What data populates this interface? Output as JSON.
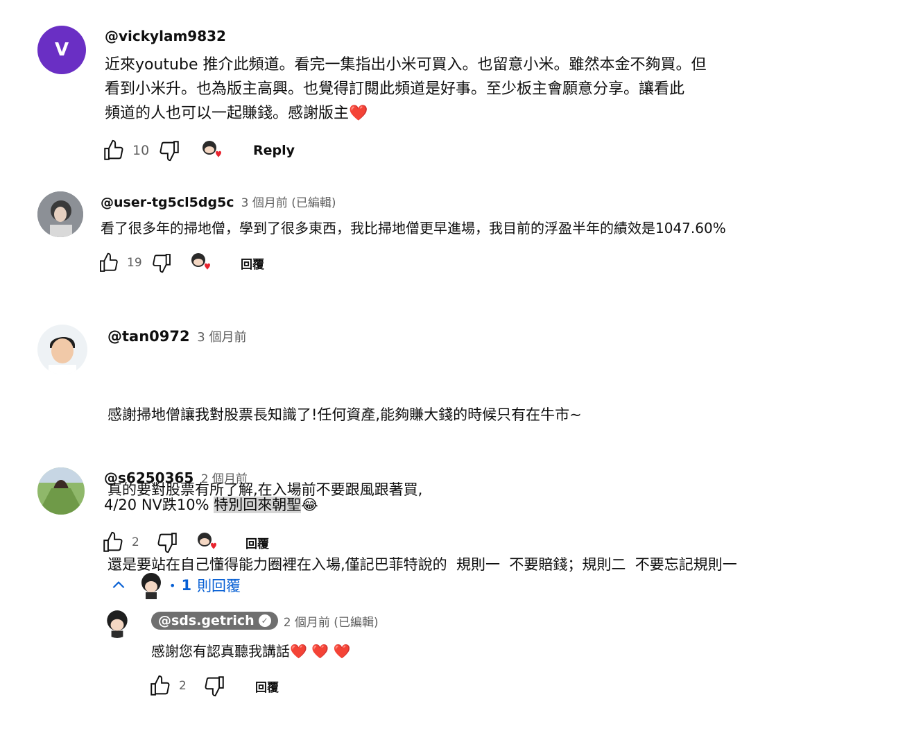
{
  "comments": [
    {
      "avatar_letter": "V",
      "handle": "@vickylam9832",
      "meta": "",
      "lines": [
        "近來youtube 推介此頻道。看完一集指出小米可買入。也留意小米。雖然本金不夠買。但",
        "看到小米升。也為版主高興。也覺得訂閱此頻道是好事。至少板主會願意分享。讓看此",
        "頻道的人也可以一起賺錢。感謝版主"
      ],
      "like_count": "10",
      "reply_label": "Reply"
    },
    {
      "handle": "@user-tg5cl5dg5c",
      "meta": "3 個月前 (已編輯)",
      "lines": [
        "看了很多年的掃地僧，學到了很多東西，我比掃地僧更早進場，我目前的浮盈半年的績效是1047.60%"
      ],
      "like_count": "19",
      "reply_label": "回覆"
    },
    {
      "handle": "@tan0972",
      "meta": "3 個月前",
      "lines": [
        "感謝掃地僧讓我對股票長知識了!任何資產,能夠賺大錢的時候只有在牛市~",
        "真的要對股票有所了解,在入場前不要跟風跟著買,",
        "還是要站在自己懂得能力圈裡在入場,僅記巴菲特說的  規則一  不要賠錢；規則二  不要忘記規則一"
      ]
    },
    {
      "handle": "@s6250365",
      "meta": "2 個月前",
      "text_plain": "4/20 NV跌10% ",
      "text_highlight": "特別回來朝聖",
      "like_count": "2",
      "reply_label": "回覆",
      "replies_toggle": {
        "count": "1",
        "label": "則回覆"
      }
    }
  ],
  "reply": {
    "handle": "@sds.getrich",
    "meta": "2 個月前 (已編輯)",
    "text": "感謝您有認真聽我講話",
    "like_count": "2",
    "reply_label": "回覆"
  },
  "colors": {
    "avatar_v": "#6a2fc4",
    "heart": "#e8232d",
    "link_blue": "#065fd4",
    "creator_chip": "#6f6f6f"
  },
  "icons": {
    "like": "thumb-up-icon",
    "dislike": "thumb-down-icon",
    "creator_heart": "creator-heart-icon",
    "collapse": "chevron-up-icon",
    "verified": "check-circle-icon",
    "emoji": "laughing-emoji-icon"
  }
}
